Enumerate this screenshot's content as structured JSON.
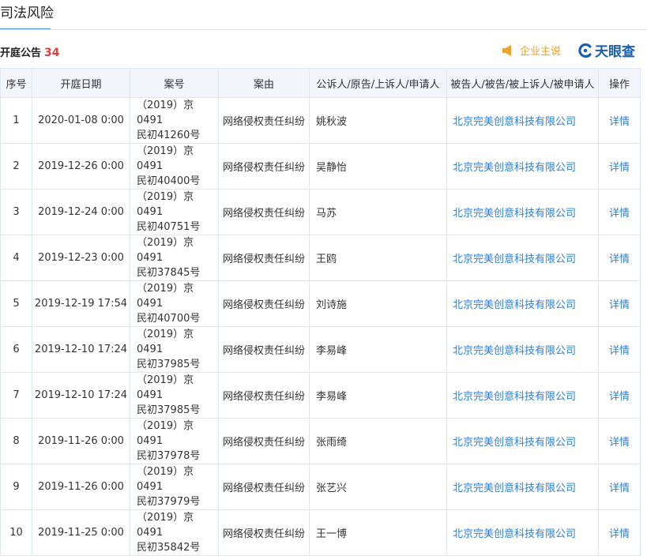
{
  "page": {
    "top_tab": "司法风险",
    "section_title": "开庭公告",
    "section_count": "34",
    "promo_text": "企业主说",
    "promo_icon": "speaker-icon",
    "logo_text": "天眼查",
    "colors": {
      "accent": "#2c7fd4",
      "count": "#e23c3c",
      "promo": "#e89f2d",
      "header_bg": "#f2f6fb"
    }
  },
  "table": {
    "headers": [
      "序号",
      "开庭日期",
      "案号",
      "案由",
      "公诉人/原告/上诉人/申请人",
      "被告人/被告/被上诉人/被申请人",
      "操作"
    ],
    "rows": [
      {
        "no": "1",
        "date": "2020-01-08 0:00",
        "case_line1": "（2019）京0491",
        "case_line2": "民初41260号",
        "cause": "网络侵权责任纠纷",
        "plaintiff": "姚秋波",
        "defendant": "北京完美创意科技有限公司",
        "action": "详情"
      },
      {
        "no": "2",
        "date": "2019-12-26 0:00",
        "case_line1": "（2019）京0491",
        "case_line2": "民初40400号",
        "cause": "网络侵权责任纠纷",
        "plaintiff": "吴静怡",
        "defendant": "北京完美创意科技有限公司",
        "action": "详情"
      },
      {
        "no": "3",
        "date": "2019-12-24 0:00",
        "case_line1": "（2019）京0491",
        "case_line2": "民初40751号",
        "cause": "网络侵权责任纠纷",
        "plaintiff": "马苏",
        "defendant": "北京完美创意科技有限公司",
        "action": "详情"
      },
      {
        "no": "4",
        "date": "2019-12-23 0:00",
        "case_line1": "（2019）京0491",
        "case_line2": "民初37845号",
        "cause": "网络侵权责任纠纷",
        "plaintiff": "王鸥",
        "defendant": "北京完美创意科技有限公司",
        "action": "详情"
      },
      {
        "no": "5",
        "date": "2019-12-19 17:54",
        "case_line1": "（2019）京0491",
        "case_line2": "民初40700号",
        "cause": "网络侵权责任纠纷",
        "plaintiff": "刘诗施",
        "defendant": "北京完美创意科技有限公司",
        "action": "详情"
      },
      {
        "no": "6",
        "date": "2019-12-10 17:24",
        "case_line1": "（2019）京0491",
        "case_line2": "民初37985号",
        "cause": "网络侵权责任纠纷",
        "plaintiff": "李易峰",
        "defendant": "北京完美创意科技有限公司",
        "action": "详情"
      },
      {
        "no": "7",
        "date": "2019-12-10 17:24",
        "case_line1": "（2019）京0491",
        "case_line2": "民初37985号",
        "cause": "网络侵权责任纠纷",
        "plaintiff": "李易峰",
        "defendant": "北京完美创意科技有限公司",
        "action": "详情"
      },
      {
        "no": "8",
        "date": "2019-11-26 0:00",
        "case_line1": "（2019）京0491",
        "case_line2": "民初37978号",
        "cause": "网络侵权责任纠纷",
        "plaintiff": "张雨绮",
        "defendant": "北京完美创意科技有限公司",
        "action": "详情"
      },
      {
        "no": "9",
        "date": "2019-11-26 0:00",
        "case_line1": "（2019）京0491",
        "case_line2": "民初37979号",
        "cause": "网络侵权责任纠纷",
        "plaintiff": "张艺兴",
        "defendant": "北京完美创意科技有限公司",
        "action": "详情"
      },
      {
        "no": "10",
        "date": "2019-11-25 0:00",
        "case_line1": "（2019）京0491",
        "case_line2": "民初35842号",
        "cause": "网络侵权责任纠纷",
        "plaintiff": "王一博",
        "defendant": "北京完美创意科技有限公司",
        "action": "详情"
      }
    ]
  }
}
